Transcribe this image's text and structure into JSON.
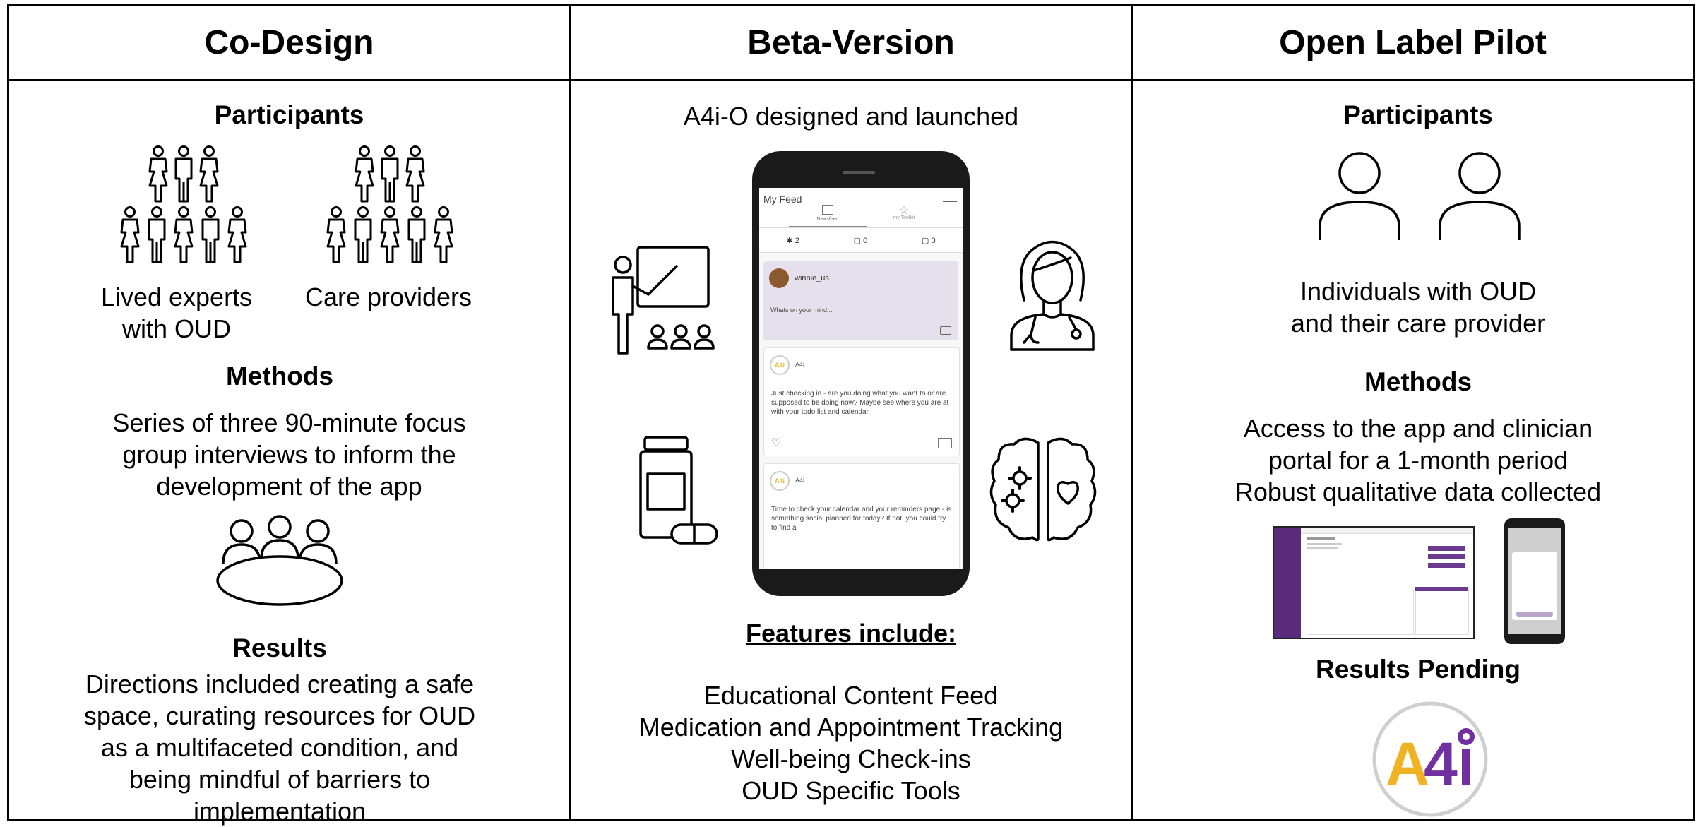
{
  "colors": {
    "accent": "#7030a0",
    "phone_post_bg": "#e6e0ec",
    "logo_gold": "#f0b323",
    "logo_purple": "#7030a0"
  },
  "columns": [
    {
      "title": "Co-Design",
      "participants_heading": "Participants",
      "groups": [
        {
          "label": "Lived experts\nwith OUD"
        },
        {
          "label": "Care providers"
        }
      ],
      "methods_heading": "Methods",
      "methods_text": "Series of three 90-minute focus\ngroup interviews to inform the\ndevelopment of the app",
      "results_heading": "Results",
      "results_text": "Directions included creating a safe\nspace, curating resources for OUD\nas a multifaceted condition, and\nbeing mindful of barriers to\nimplementation"
    },
    {
      "title": "Beta-Version",
      "intro": "A4i-O designed and launched",
      "features_heading": "Features include:",
      "features": [
        "Educational Content Feed",
        "Medication and Appointment Tracking",
        "Well-being Check-ins",
        "OUD Specific Tools"
      ]
    },
    {
      "title": "Open Label Pilot",
      "participants_heading": "Participants",
      "participants_text": "Individuals with OUD\nand their care provider",
      "methods_heading": "Methods",
      "methods_text": "Access to the app and clinician\nportal for a 1-month period\nRobust qualitative data collected",
      "results_heading": "Results Pending"
    }
  ],
  "phone": {
    "header_title": "My Feed",
    "tabs": [
      {
        "label": "Newsfeed",
        "icon": "list-icon"
      },
      {
        "label": "my Toolkit",
        "icon": "star-icon"
      }
    ],
    "counters": [
      {
        "icon": "asterisk-icon",
        "value": "2"
      },
      {
        "icon": "calendar-icon",
        "value": "0"
      },
      {
        "icon": "calendar-icon",
        "value": "0"
      }
    ],
    "composer": {
      "user": "winnie_us",
      "placeholder": "Whats on your mind..."
    },
    "posts": [
      {
        "author": "A4i",
        "text": "Just checking in  - are you doing what you want to or are supposed to be doing now? Maybe see where you are at with your todo list and calendar."
      },
      {
        "author": "A4i",
        "text": "Time to check your calendar and your reminders page - is something social planned for today? If not, you could try to find a"
      }
    ]
  },
  "logo": {
    "text": "A4i"
  }
}
